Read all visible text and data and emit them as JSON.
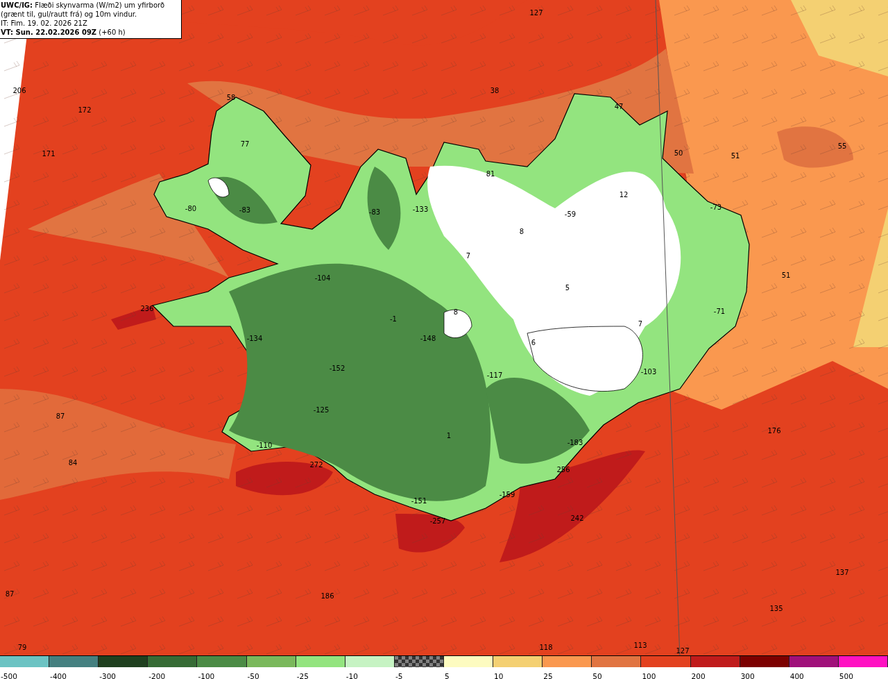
{
  "header": {
    "title": "**UWC/IG:** Flæði skynvarma (W/m2) um yfirborð (grænt til, gul/rautt frá) og 10m vindur.",
    "initial_time": "IT: Fim. 19. 02. 2026 21Z",
    "valid_time": "**VT: Sun. 22.02.2026 09Z** (+60 h)"
  },
  "map": {
    "value_labels": [
      {
        "text": "127"
      },
      {
        "text": "206"
      },
      {
        "text": "172"
      },
      {
        "text": "171"
      },
      {
        "text": "58"
      },
      {
        "text": "38"
      },
      {
        "text": "47"
      },
      {
        "text": "77"
      },
      {
        "text": "50"
      },
      {
        "text": "51"
      },
      {
        "text": "55"
      },
      {
        "text": "81"
      },
      {
        "text": "12"
      },
      {
        "text": "-80"
      },
      {
        "text": "-83"
      },
      {
        "text": "-83"
      },
      {
        "text": "-133"
      },
      {
        "text": "-73"
      },
      {
        "text": "-59"
      },
      {
        "text": "8"
      },
      {
        "text": "7"
      },
      {
        "text": "51"
      },
      {
        "text": "5"
      },
      {
        "text": "-104"
      },
      {
        "text": "236"
      },
      {
        "text": "8"
      },
      {
        "text": "-1"
      },
      {
        "text": "-71"
      },
      {
        "text": "7"
      },
      {
        "text": "-134"
      },
      {
        "text": "-148"
      },
      {
        "text": "6"
      },
      {
        "text": "-152"
      },
      {
        "text": "-103"
      },
      {
        "text": "-117"
      },
      {
        "text": "-125"
      },
      {
        "text": "87"
      },
      {
        "text": "176"
      },
      {
        "text": "1"
      },
      {
        "text": "-110"
      },
      {
        "text": "-183"
      },
      {
        "text": "84"
      },
      {
        "text": "272"
      },
      {
        "text": "256"
      },
      {
        "text": "-159"
      },
      {
        "text": "-151"
      },
      {
        "text": "242"
      },
      {
        "text": "-257"
      },
      {
        "text": "137"
      },
      {
        "text": "87"
      },
      {
        "text": "186"
      },
      {
        "text": "135"
      },
      {
        "text": "79"
      },
      {
        "text": "118"
      },
      {
        "text": "113"
      },
      {
        "text": "127"
      }
    ]
  },
  "legend": [
    {
      "label": "-500",
      "color": "#6cc3c3",
      "kind": "solid"
    },
    {
      "label": "-400",
      "color": "#448080",
      "kind": "solid"
    },
    {
      "label": "-300",
      "color": "#1f401f",
      "kind": "solid"
    },
    {
      "label": "-200",
      "color": "#366b35",
      "kind": "solid"
    },
    {
      "label": "-100",
      "color": "#4b8b45",
      "kind": "solid"
    },
    {
      "label": "-50",
      "color": "#7ab85b",
      "kind": "solid"
    },
    {
      "label": "-25",
      "color": "#93e47f",
      "kind": "solid"
    },
    {
      "label": "-10",
      "color": "#c6f3c3",
      "kind": "solid"
    },
    {
      "label": "-5",
      "color": "#808080",
      "kind": "checker"
    },
    {
      "label": "5",
      "color": "#fdfbc0",
      "kind": "solid"
    },
    {
      "label": "10",
      "color": "#f4d072",
      "kind": "solid"
    },
    {
      "label": "25",
      "color": "#fa984f",
      "kind": "solid"
    },
    {
      "label": "50",
      "color": "#e17441",
      "kind": "solid"
    },
    {
      "label": "100",
      "color": "#e3411f",
      "kind": "solid"
    },
    {
      "label": "200",
      "color": "#c01b1b",
      "kind": "solid"
    },
    {
      "label": "300",
      "color": "#7c0000",
      "kind": "solid"
    },
    {
      "label": "400",
      "color": "#a0107a",
      "kind": "solid"
    },
    {
      "label": "500",
      "color": "#ff12c2",
      "kind": "solid"
    }
  ]
}
